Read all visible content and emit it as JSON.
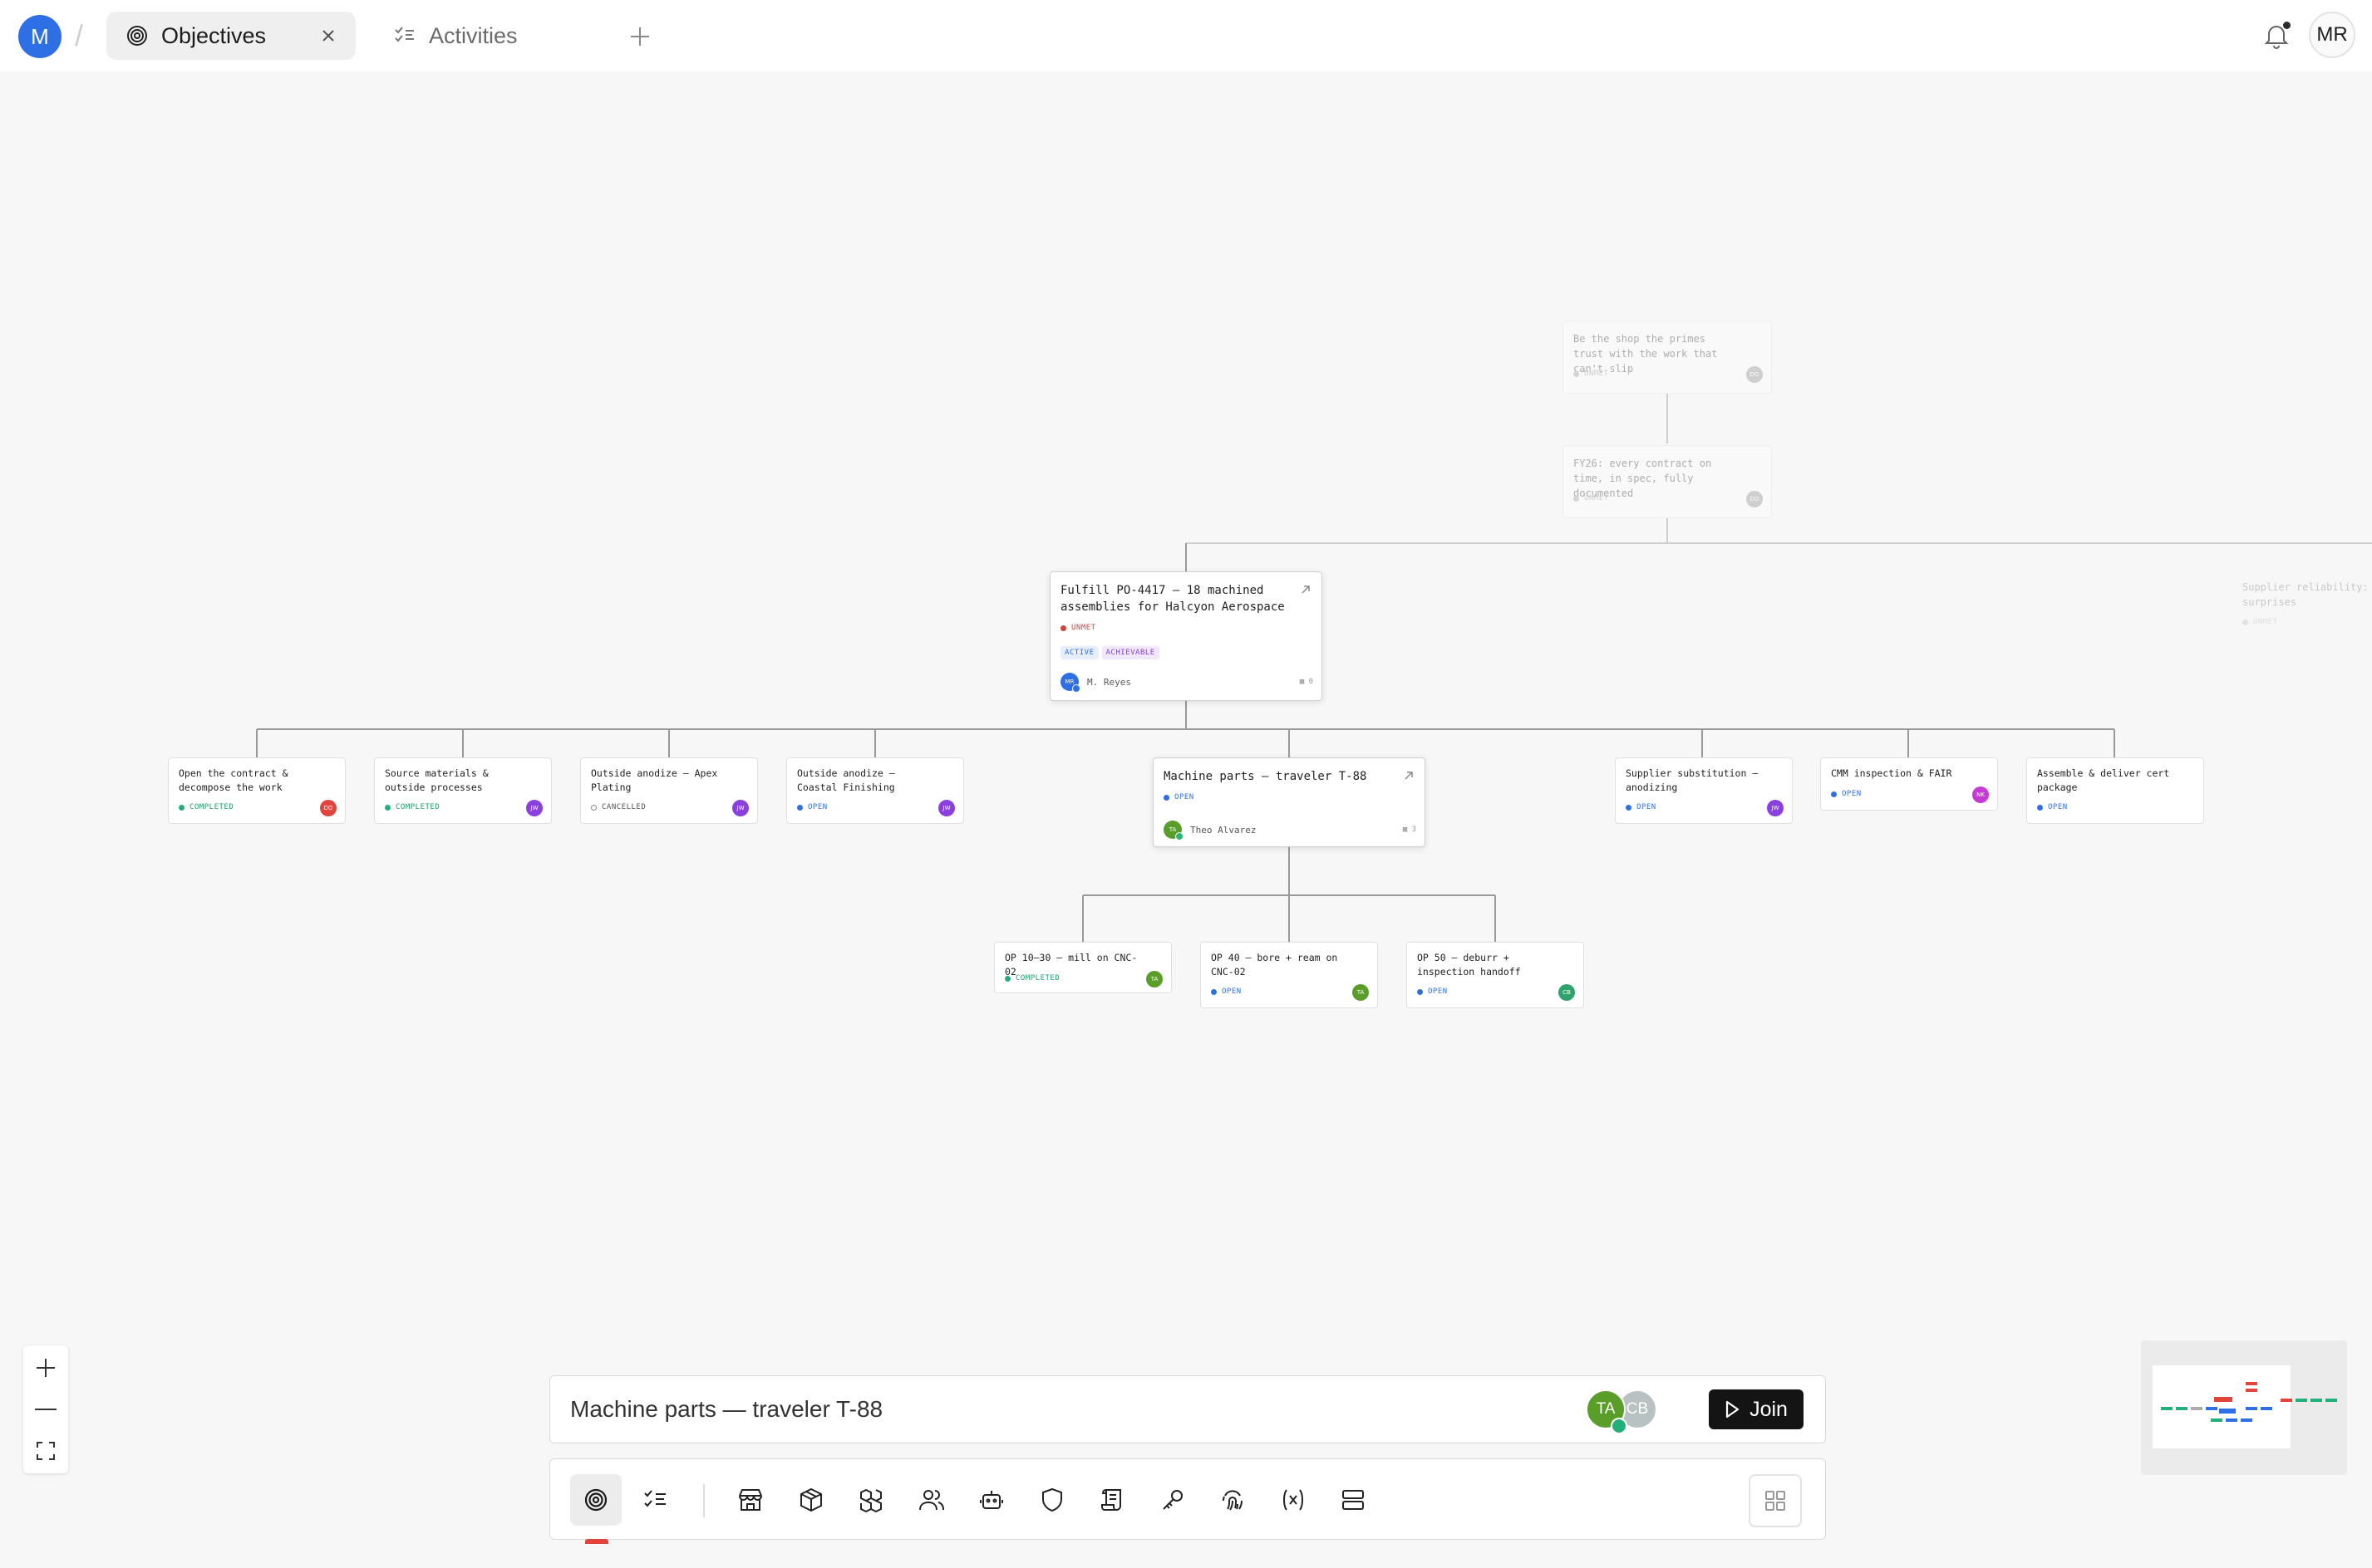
{
  "header": {
    "workspace_initial": "M",
    "tabs": [
      {
        "label": "Objectives",
        "icon": "target-icon",
        "active": true
      },
      {
        "label": "Activities",
        "icon": "checklist-icon",
        "active": false
      }
    ],
    "user_initials": "MR"
  },
  "canvas": {
    "nodes": [
      {
        "title": "Be the shop the primes trust with the work that can't slip",
        "status": "UNMET",
        "avatar": "DO",
        "faded": true
      },
      {
        "title": "FY26: every contract on time, in spec, fully documented",
        "status": "UNMET",
        "avatar": "DO",
        "faded": true
      },
      {
        "title": "Supplier reliability: cert surprises",
        "status": "UNMET",
        "faded": true
      },
      {
        "title": "Fulfill PO-4417 — 18 machined assemblies for Halcyon Aerospace",
        "status": "UNMET",
        "tags": [
          "ACTIVE",
          "ACHIEVABLE"
        ],
        "avatar": "MR",
        "owner": "M. Reyes",
        "comments": "0",
        "color": "#2f6fe6"
      },
      {
        "title": "Open the contract & decompose the work",
        "status": "COMPLETED",
        "avatar": "DO",
        "color": "#e0443a"
      },
      {
        "title": "Source materials & outside processes",
        "status": "COMPLETED",
        "avatar": "JW",
        "color": "#8a3fe0"
      },
      {
        "title": "Outside anodize — Apex Plating",
        "status": "CANCELLED",
        "avatar": "JW",
        "color": "#8a3fe0"
      },
      {
        "title": "Outside anodize — Coastal Finishing",
        "status": "OPEN",
        "avatar": "JW",
        "color": "#8a3fe0"
      },
      {
        "title": "Machine parts — traveler T-88",
        "status": "OPEN",
        "avatar": "TA",
        "owner": "Theo Alvarez",
        "comments": "3",
        "color": "#5a9e2a"
      },
      {
        "title": "Supplier substitution — anodizing",
        "status": "OPEN",
        "avatar": "JW",
        "color": "#8a3fe0"
      },
      {
        "title": "CMM inspection & FAIR",
        "status": "OPEN",
        "avatar": "NK",
        "color": "#c83ad6"
      },
      {
        "title": "Assemble & deliver cert package",
        "status": "OPEN"
      },
      {
        "title": "OP 10–30 — mill on CNC-02",
        "status": "COMPLETED",
        "avatar": "TA",
        "color": "#5a9e2a"
      },
      {
        "title": "OP 40 — bore + ream on CNC-02",
        "status": "OPEN",
        "avatar": "TA",
        "color": "#5a9e2a"
      },
      {
        "title": "OP 50 — deburr + inspection handoff",
        "status": "OPEN",
        "avatar": "CB",
        "color": "#2ea36e"
      }
    ]
  },
  "chatbar": {
    "title": "Machine parts — traveler T-88",
    "participants": [
      {
        "initials": "TA",
        "color": "#5a9e2a"
      },
      {
        "initials": "CB",
        "color": "#b8c2c2"
      }
    ],
    "join_label": "Join"
  },
  "dock": {
    "items": [
      "target-icon",
      "checklist-icon",
      "store-icon",
      "box-icon",
      "boxes-icon",
      "users-icon",
      "robot-icon",
      "shield-icon",
      "scroll-icon",
      "key-icon",
      "fingerprint-icon",
      "variable-icon",
      "layers-icon"
    ],
    "apps_icon": "grid-icon"
  }
}
